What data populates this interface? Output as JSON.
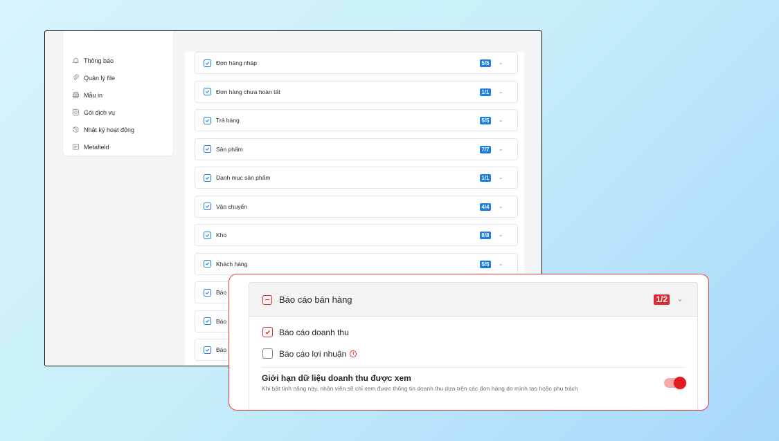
{
  "sidebar": {
    "items": [
      {
        "label": "Thông báo",
        "icon": "bell-icon"
      },
      {
        "label": "Quản lý file",
        "icon": "paperclip-icon"
      },
      {
        "label": "Mẫu in",
        "icon": "printer-icon"
      },
      {
        "label": "Gói dịch vụ",
        "icon": "package-icon"
      },
      {
        "label": "Nhật ký hoạt động",
        "icon": "history-icon"
      },
      {
        "label": "Metafield",
        "icon": "list-icon"
      }
    ]
  },
  "permissions": [
    {
      "label": "Đơn hàng nháp",
      "badge": "5/5"
    },
    {
      "label": "Đơn hàng chưa hoàn tất",
      "badge": "1/1"
    },
    {
      "label": "Trả hàng",
      "badge": "5/5"
    },
    {
      "label": "Sản phẩm",
      "badge": "7/7"
    },
    {
      "label": "Danh mục sản phẩm",
      "badge": "1/1"
    },
    {
      "label": "Vận chuyển",
      "badge": "4/4"
    },
    {
      "label": "Kho",
      "badge": "8/8"
    },
    {
      "label": "Khách hàng",
      "badge": "5/5"
    },
    {
      "label": "Báo",
      "badge": ""
    },
    {
      "label": "Báo",
      "badge": ""
    },
    {
      "label": "Báo",
      "badge": ""
    }
  ],
  "popup": {
    "title": "Báo cáo bán hàng",
    "badge": "1/2",
    "options": [
      {
        "label": "Báo cáo doanh thu",
        "checked": true
      },
      {
        "label": "Báo cáo lợi nhuận",
        "checked": false,
        "info": "i"
      }
    ],
    "limit": {
      "title": "Giới hạn dữ liệu doanh thu được xem",
      "description": "Khi bật tính năng này, nhân viên sẽ chỉ xem được thông tin doanh thu dựa trên các đơn hàng do mình tạo hoặc phụ trách",
      "enabled": true
    }
  },
  "colors": {
    "accent_blue": "#1a7ce6",
    "accent_red": "#e0282f",
    "toggle_track": "#f7a7a7"
  }
}
